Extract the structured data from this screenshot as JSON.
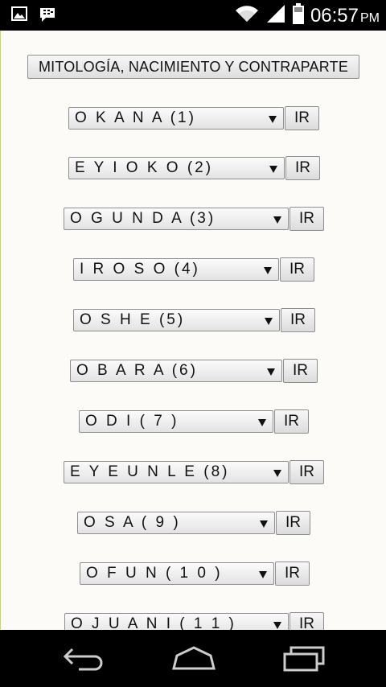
{
  "status_bar": {
    "time": "06:57",
    "ampm": "PM",
    "icons": [
      "image-icon",
      "bbm-icon",
      "wifi-icon",
      "signal-icon",
      "battery-icon"
    ]
  },
  "title_button": "MITOLOGÍA, NACIMIENTO Y CONTRAPARTE",
  "button_label": "IR",
  "odus": [
    "O K A N A (1)",
    "E Y I O K O (2)",
    "O G U N D A (3)",
    "I R O S O (4)",
    "O S H E (5)",
    "O B A R A (6)",
    "O D I ( 7 )",
    "E Y E U N L E (8)",
    "O S A ( 9 )",
    "O F U N ( 1 0 )",
    "O J U A N I ( 1 1 )"
  ],
  "nav_bar": {
    "icons": [
      "back-icon",
      "home-icon",
      "recent-apps-icon"
    ]
  }
}
